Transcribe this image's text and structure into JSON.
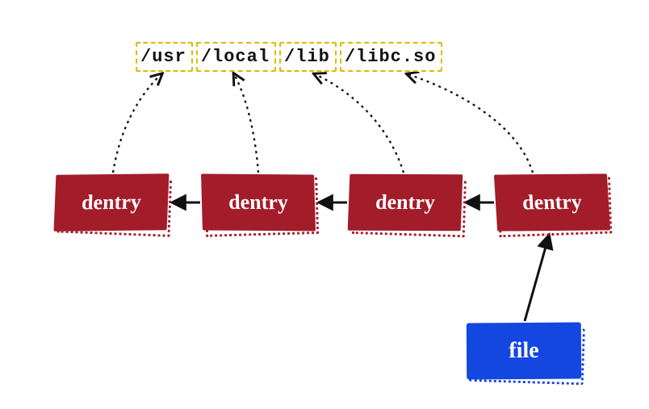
{
  "path": {
    "segments": [
      "/usr",
      "/local",
      "/lib",
      "/libc.so"
    ]
  },
  "nodes": {
    "dentry_label": "dentry",
    "file_label": "file"
  },
  "colors": {
    "dentry_fill": "#a21c2a",
    "file_fill": "#1446e0",
    "segment_border": "#e0b800"
  },
  "edges": [
    {
      "from": "dentry-2",
      "to": "dentry-1",
      "style": "solid"
    },
    {
      "from": "dentry-3",
      "to": "dentry-2",
      "style": "solid"
    },
    {
      "from": "dentry-4",
      "to": "dentry-3",
      "style": "solid"
    },
    {
      "from": "file",
      "to": "dentry-4",
      "style": "solid"
    },
    {
      "from": "dentry-1",
      "to": "segment-1",
      "style": "dashed"
    },
    {
      "from": "dentry-2",
      "to": "segment-2",
      "style": "dashed"
    },
    {
      "from": "dentry-3",
      "to": "segment-3",
      "style": "dashed"
    },
    {
      "from": "dentry-4",
      "to": "segment-4",
      "style": "dashed"
    }
  ]
}
